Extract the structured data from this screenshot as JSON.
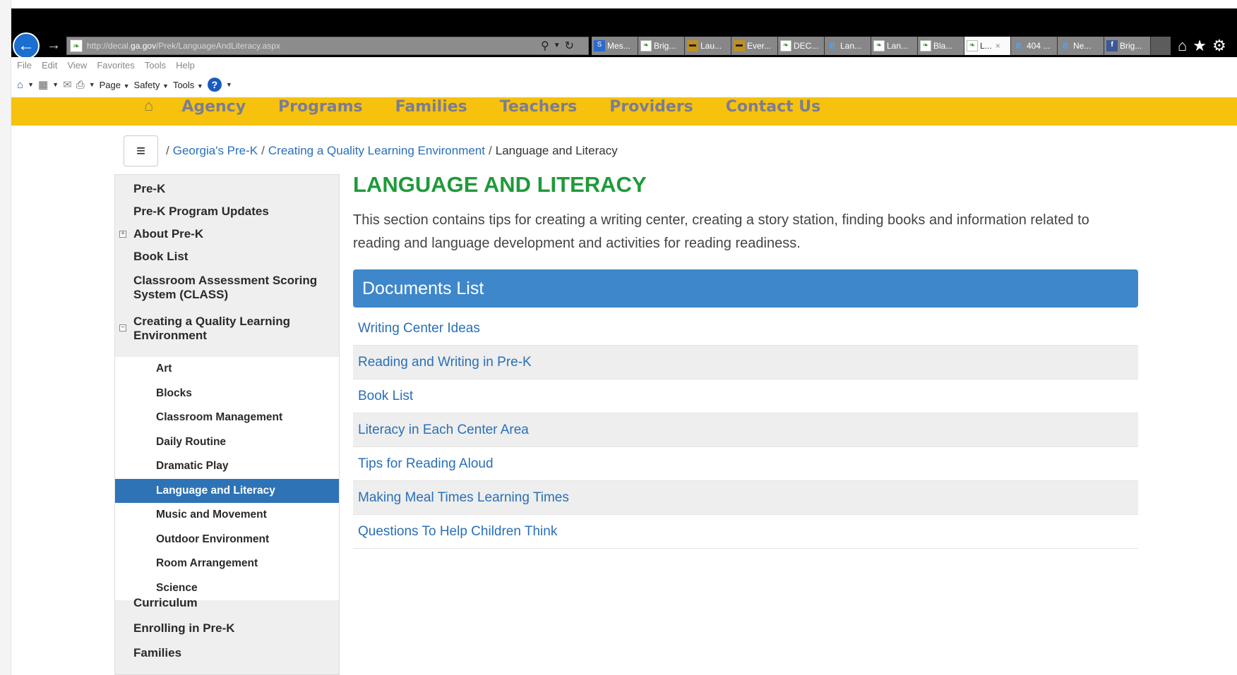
{
  "browser": {
    "url_prefix": "http://decal.",
    "url_domain": "ga.gov",
    "url_path": "/Prek/LanguageAndLiteracy.aspx",
    "tabs": [
      {
        "label": "Mes...",
        "icon": "blue"
      },
      {
        "label": "Brig...",
        "icon": "site"
      },
      {
        "label": "Lau...",
        "icon": "brn"
      },
      {
        "label": "Ever...",
        "icon": "brn"
      },
      {
        "label": "DEC...",
        "icon": "site"
      },
      {
        "label": "Lan...",
        "icon": "ie"
      },
      {
        "label": "Lan...",
        "icon": "site"
      },
      {
        "label": "Bla...",
        "icon": "site"
      },
      {
        "label": "L...",
        "icon": "site",
        "active": true
      },
      {
        "label": "404 ...",
        "icon": "ie"
      },
      {
        "label": "Ne...",
        "icon": "ie"
      },
      {
        "label": "Brig...",
        "icon": "fb"
      }
    ],
    "menu": [
      "File",
      "Edit",
      "View",
      "Favorites",
      "Tools",
      "Help"
    ],
    "commands": {
      "page": "Page",
      "safety": "Safety",
      "tools": "Tools"
    }
  },
  "site_nav": [
    "Agency",
    "Programs",
    "Families",
    "Teachers",
    "Providers",
    "Contact Us"
  ],
  "breadcrumb": {
    "link1": "Georgia's Pre-K",
    "link2": "Creating a Quality Learning Environment",
    "current": "Language and Literacy"
  },
  "sidebar": {
    "top_items": [
      {
        "label": "Pre-K"
      },
      {
        "label": "Pre-K Program Updates"
      },
      {
        "label": "About Pre-K",
        "expander": "+"
      },
      {
        "label": "Book List"
      },
      {
        "label": "Classroom Assessment Scoring System (CLASS)"
      },
      {
        "label": "Creating a Quality Learning Environment",
        "expander": "−"
      }
    ],
    "sub_items": [
      "Art",
      "Blocks",
      "Classroom Management",
      "Daily Routine",
      "Dramatic Play",
      "Language and Literacy",
      "Music and Movement",
      "Outdoor Environment",
      "Room Arrangement",
      "Science"
    ],
    "active_sub": "Language and Literacy",
    "bottom_items": [
      "Curriculum",
      "Enrolling in Pre-K",
      "Families"
    ]
  },
  "main": {
    "title": "LANGUAGE AND LITERACY",
    "intro": "This section contains tips for creating a writing center, creating a story station, finding books and information related to reading and language development and activities for reading readiness.",
    "docs_header": "Documents List",
    "docs": [
      "Writing Center Ideas",
      "Reading and Writing in Pre-K",
      "Book List",
      "Literacy in Each Center Area",
      "Tips for Reading Aloud",
      "Making Meal Times Learning Times",
      "Questions To Help Children Think"
    ]
  }
}
